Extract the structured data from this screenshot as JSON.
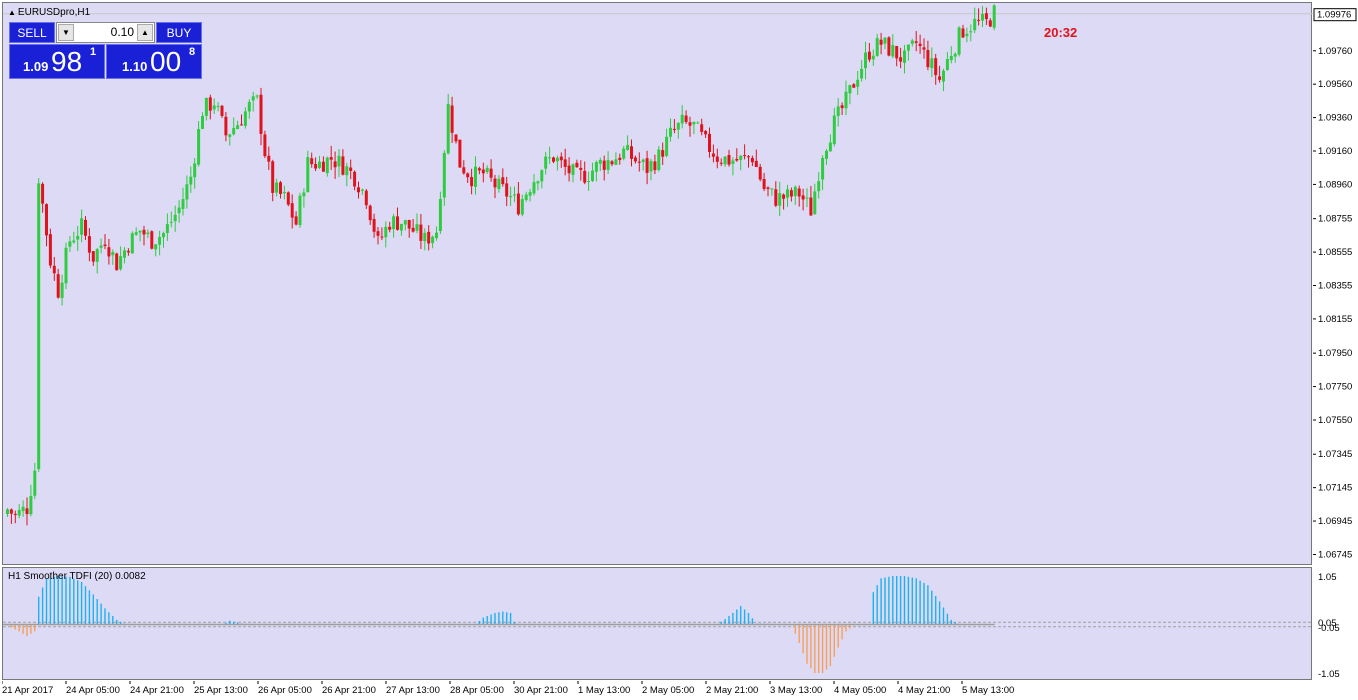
{
  "window": {
    "symbol_title": "EURUSDpro,H1"
  },
  "trade_panel": {
    "sell_label": "SELL",
    "buy_label": "BUY",
    "volume": "0.10",
    "sell_price_prefix": "1.09",
    "sell_price_big": "98",
    "sell_price_sup": "1",
    "buy_price_prefix": "1.10",
    "buy_price_big": "00",
    "buy_price_sup": "8"
  },
  "clock_text": "20:32",
  "colors": {
    "background": "#dddaf6",
    "bull_candle": "#2ecc40",
    "bear_candle": "#e0121b",
    "histogram_positive": "#1ab2f0",
    "histogram_negative": "#f7a05a",
    "signal_line": "#9e9e9e",
    "clock": "#e0121b"
  },
  "indicator": {
    "title": "H1 Smoother TDFI (20) 0.0082",
    "axis_labels": [
      "1.05",
      "0.05",
      "-0.05",
      "-1.05"
    ]
  },
  "price_axis": {
    "labels": [
      "1.09760",
      "1.09560",
      "1.09360",
      "1.09160",
      "1.08960",
      "1.08755",
      "1.08555",
      "1.08355",
      "1.08155",
      "1.07950",
      "1.07750",
      "1.07550",
      "1.07345",
      "1.07145",
      "1.06945",
      "1.06745"
    ],
    "current_price": "1.09976"
  },
  "time_axis": {
    "labels": [
      "21 Apr 2017",
      "24 Apr 05:00",
      "24 Apr 21:00",
      "25 Apr 13:00",
      "26 Apr 05:00",
      "26 Apr 21:00",
      "27 Apr 13:00",
      "28 Apr 05:00",
      "30 Apr 21:00",
      "1 May 13:00",
      "2 May 05:00",
      "2 May 21:00",
      "3 May 13:00",
      "4 May 05:00",
      "4 May 21:00",
      "5 May 13:00"
    ]
  },
  "chart_data": [
    {
      "type": "candlestick",
      "title": "EURUSDpro,H1",
      "x_labels": [
        "21 Apr 2017",
        "24 Apr 05:00",
        "24 Apr 21:00",
        "25 Apr 13:00",
        "26 Apr 05:00",
        "26 Apr 21:00",
        "27 Apr 13:00",
        "28 Apr 05:00",
        "30 Apr 21:00",
        "1 May 13:00",
        "2 May 05:00",
        "2 May 21:00",
        "3 May 13:00",
        "4 May 05:00",
        "4 May 21:00",
        "5 May 13:00"
      ],
      "ylim": [
        1.0667,
        1.1004
      ],
      "close_path": [
        [
          0,
          1.0701
        ],
        [
          2,
          1.0697
        ],
        [
          5,
          1.0702
        ],
        [
          7,
          1.0725
        ],
        [
          8,
          1.09
        ],
        [
          11,
          1.085
        ],
        [
          13,
          1.0832
        ],
        [
          16,
          1.0862
        ],
        [
          19,
          1.087
        ],
        [
          22,
          1.0852
        ],
        [
          25,
          1.0863
        ],
        [
          28,
          1.0848
        ],
        [
          31,
          1.086
        ],
        [
          34,
          1.0868
        ],
        [
          37,
          1.0862
        ],
        [
          40,
          1.0866
        ],
        [
          44,
          1.0881
        ],
        [
          47,
          1.09
        ],
        [
          50,
          1.094
        ],
        [
          53,
          1.0945
        ],
        [
          56,
          1.0925
        ],
        [
          59,
          1.0932
        ],
        [
          62,
          1.0942
        ],
        [
          64,
          1.0945
        ],
        [
          66,
          1.0915
        ],
        [
          68,
          1.0893
        ],
        [
          71,
          1.0887
        ],
        [
          74,
          1.0872
        ],
        [
          77,
          1.0908
        ],
        [
          80,
          1.0908
        ],
        [
          83,
          1.0911
        ],
        [
          86,
          1.0907
        ],
        [
          89,
          1.09
        ],
        [
          92,
          1.0888
        ],
        [
          95,
          1.086
        ],
        [
          98,
          1.0873
        ],
        [
          101,
          1.0873
        ],
        [
          104,
          1.0868
        ],
        [
          107,
          1.0862
        ],
        [
          110,
          1.0868
        ],
        [
          113,
          1.0942
        ],
        [
          116,
          1.0908
        ],
        [
          119,
          1.09
        ],
        [
          122,
          1.0902
        ],
        [
          125,
          1.0895
        ],
        [
          128,
          1.089
        ],
        [
          131,
          1.0883
        ],
        [
          134,
          1.0895
        ],
        [
          137,
          1.0906
        ],
        [
          140,
          1.0912
        ],
        [
          143,
          1.0905
        ],
        [
          146,
          1.09
        ],
        [
          149,
          1.0902
        ],
        [
          152,
          1.0908
        ],
        [
          155,
          1.091
        ],
        [
          158,
          1.0915
        ],
        [
          161,
          1.091
        ],
        [
          164,
          1.0905
        ],
        [
          167,
          1.0912
        ],
        [
          170,
          1.0925
        ],
        [
          173,
          1.0932
        ],
        [
          176,
          1.093
        ],
        [
          179,
          1.092
        ],
        [
          182,
          1.0912
        ],
        [
          185,
          1.091
        ],
        [
          188,
          1.091
        ],
        [
          191,
          1.0912
        ],
        [
          194,
          1.0893
        ],
        [
          197,
          1.0887
        ],
        [
          200,
          1.0888
        ],
        [
          203,
          1.089
        ],
        [
          206,
          1.088
        ],
        [
          209,
          1.0915
        ],
        [
          212,
          1.0932
        ],
        [
          215,
          1.0945
        ],
        [
          218,
          1.0962
        ],
        [
          221,
          1.0975
        ],
        [
          224,
          1.098
        ],
        [
          227,
          1.0975
        ],
        [
          230,
          1.097
        ],
        [
          233,
          1.098
        ],
        [
          236,
          1.097
        ],
        [
          239,
          1.0958
        ],
        [
          242,
          1.0975
        ],
        [
          245,
          1.0988
        ],
        [
          248,
          1.0992
        ],
        [
          251,
          1.0992
        ],
        [
          253,
          1.0998
        ]
      ],
      "current_price": 1.09976
    },
    {
      "type": "bar",
      "title": "H1 Smoother TDFI (20) 0.0082",
      "ylim": [
        -1.05,
        1.05
      ],
      "levels": [
        0.05,
        -0.05
      ],
      "value_path": [
        [
          0,
          -0.02
        ],
        [
          3,
          -0.15
        ],
        [
          5,
          -0.25
        ],
        [
          7,
          -0.15
        ],
        [
          8,
          0.6
        ],
        [
          10,
          1.0
        ],
        [
          13,
          1.05
        ],
        [
          16,
          1.03
        ],
        [
          19,
          0.92
        ],
        [
          22,
          0.65
        ],
        [
          25,
          0.35
        ],
        [
          28,
          0.1
        ],
        [
          30,
          0.02
        ],
        [
          33,
          0.0
        ],
        [
          55,
          0.0
        ],
        [
          57,
          0.08
        ],
        [
          60,
          0.02
        ],
        [
          62,
          0.0
        ],
        [
          120,
          0.0
        ],
        [
          122,
          0.15
        ],
        [
          125,
          0.25
        ],
        [
          127,
          0.28
        ],
        [
          129,
          0.25
        ],
        [
          130,
          0.05
        ],
        [
          131,
          0.0
        ],
        [
          182,
          0.0
        ],
        [
          184,
          0.12
        ],
        [
          186,
          0.25
        ],
        [
          188,
          0.4
        ],
        [
          190,
          0.25
        ],
        [
          192,
          0.02
        ],
        [
          201,
          0.0
        ],
        [
          203,
          -0.4
        ],
        [
          205,
          -0.85
        ],
        [
          207,
          -1.05
        ],
        [
          209,
          -1.05
        ],
        [
          211,
          -0.9
        ],
        [
          213,
          -0.5
        ],
        [
          215,
          -0.15
        ],
        [
          217,
          -0.02
        ],
        [
          221,
          0.0
        ],
        [
          222,
          0.7
        ],
        [
          224,
          1.0
        ],
        [
          227,
          1.05
        ],
        [
          230,
          1.05
        ],
        [
          233,
          1.0
        ],
        [
          236,
          0.85
        ],
        [
          239,
          0.5
        ],
        [
          242,
          0.1
        ],
        [
          244,
          0.0
        ],
        [
          253,
          0.0
        ]
      ],
      "signal_line_value": 0.0
    }
  ]
}
